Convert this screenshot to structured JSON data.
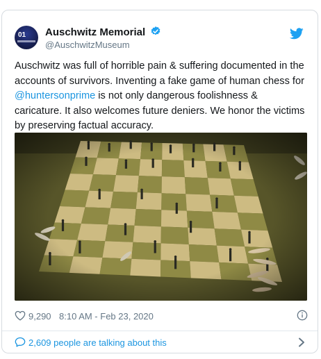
{
  "tweet": {
    "author": {
      "name": "Auschwitz Memorial",
      "handle": "@AuschwitzMuseum",
      "avatar_text": "01",
      "verified": true
    },
    "text_before": "Auschwitz was full of horrible pain & suffering documented in the accounts of survivors. Inventing a fake game of human chess for ",
    "mention": "@huntersonprime",
    "text_after": " is not only dangerous foolishness & caricature. It also welcomes future deniers. We honor the victims by preserving factual accuracy.",
    "likes": "9,290",
    "timestamp": "8:10 AM - Feb 23, 2020",
    "talking": "2,609 people are talking about this"
  },
  "colors": {
    "text": "#14171a",
    "muted": "#657786",
    "link": "#1b95e0",
    "verified": "#1da1f2",
    "border": "#d6dbe0"
  },
  "icons": {
    "verified": "verified-badge-icon",
    "twitter": "twitter-bird-icon",
    "like": "heart-icon",
    "info": "info-icon",
    "reply": "speech-bubble-icon",
    "more": "chevron-right-icon"
  }
}
